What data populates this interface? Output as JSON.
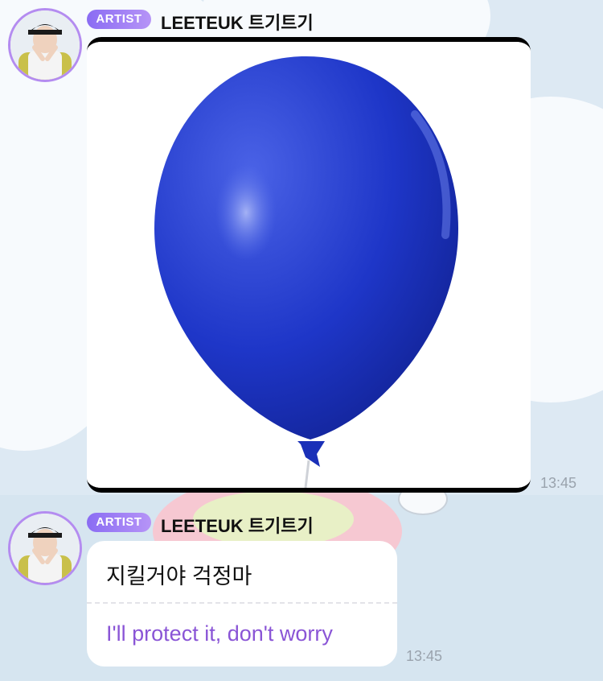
{
  "messages": [
    {
      "badge": "ARTIST",
      "sender": "LEETEUK 트기트기",
      "type": "image",
      "image_subject": "blue balloon",
      "time": "13:45"
    },
    {
      "badge": "ARTIST",
      "sender": "LEETEUK 트기트기",
      "type": "text",
      "text": "지킬거야 걱정마",
      "translation": "I'll protect it, don't worry",
      "time": "13:45"
    }
  ],
  "colors": {
    "badge_start": "#8a6cf3",
    "badge_end": "#b694f7",
    "translation_text": "#8a55d6",
    "avatar_ring": "#b48cf0",
    "balloon": "#1e36c8"
  }
}
